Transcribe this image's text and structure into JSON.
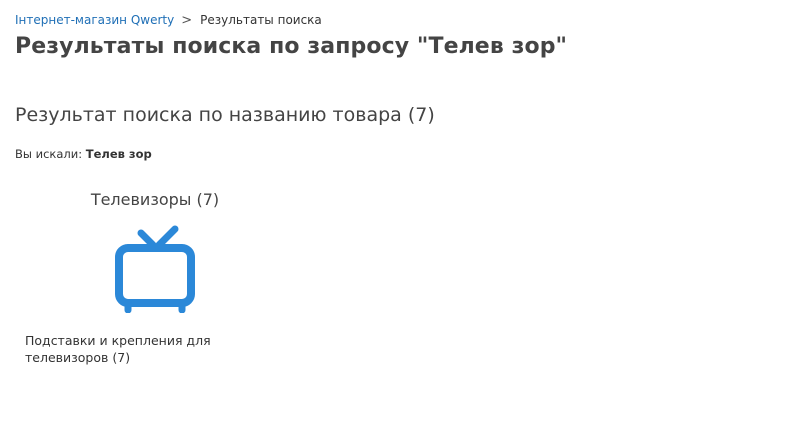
{
  "breadcrumb": {
    "home": "Інтернет-магазин Qwerty",
    "separator": ">",
    "current": "Результаты поиска"
  },
  "page_title": "Результаты поиска по запросу \"Телев зор\"",
  "section_title": "Результат поиска по названию товара (7)",
  "query": {
    "label": "Вы искали:",
    "value": "Телев зор"
  },
  "category": {
    "name": "Телевизоры (7)",
    "icon": "tv-icon",
    "icon_color": "#2b88d8"
  },
  "subcategory": {
    "label": "Подставки и крепления для телевизоров (7)"
  }
}
